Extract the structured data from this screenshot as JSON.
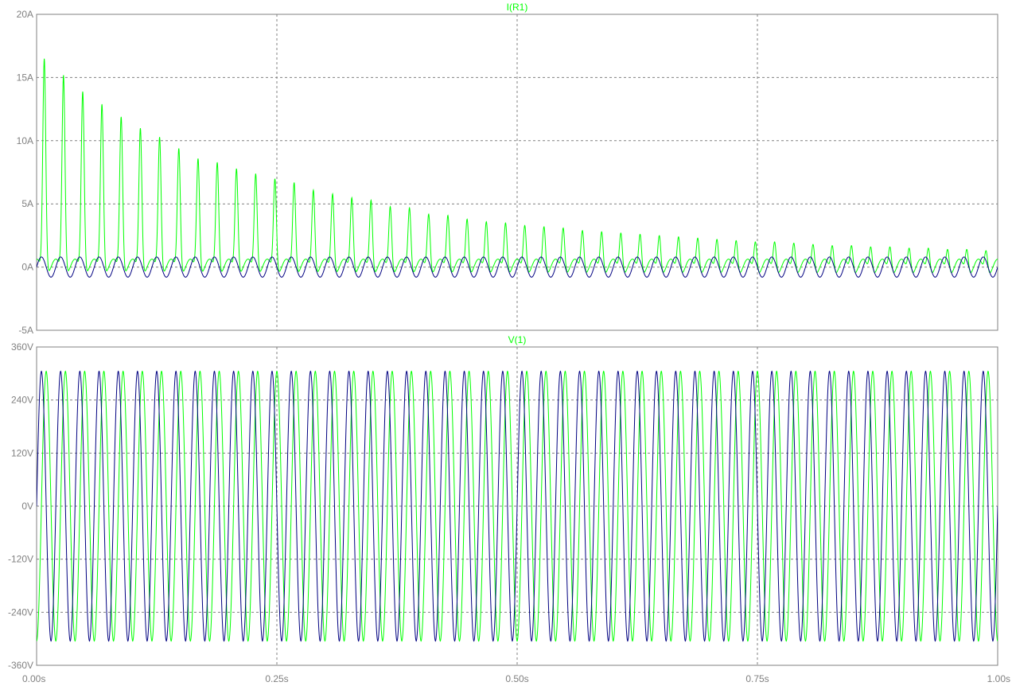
{
  "chart_data": [
    {
      "type": "line",
      "title": "I(R1)",
      "xlim": [
        0,
        1.0
      ],
      "ylim": [
        -5,
        20
      ],
      "yticks": [
        {
          "value": 20,
          "label": "20A"
        },
        {
          "value": 15,
          "label": "15A"
        },
        {
          "value": 10,
          "label": "10A"
        },
        {
          "value": 5,
          "label": "5A"
        },
        {
          "value": 0,
          "label": "0A"
        },
        {
          "value": -5,
          "label": "-5A"
        }
      ],
      "grid": true,
      "series": [
        {
          "color": "#00ff00",
          "description": "rectified current pulses, one per cycle, decaying peaks",
          "sample_peaks": {
            "t": [
              0.008,
              0.028,
              0.048,
              0.068,
              0.088,
              0.108,
              0.128,
              0.148,
              0.168,
              0.188,
              0.208,
              0.228,
              0.248,
              0.268,
              0.288,
              0.308,
              0.328,
              0.348,
              0.368,
              0.388,
              0.408,
              0.428,
              0.448,
              0.468,
              0.488,
              0.508,
              0.528,
              0.548,
              0.568,
              0.588,
              0.608,
              0.628,
              0.648,
              0.668,
              0.688,
              0.708,
              0.728,
              0.748,
              0.768,
              0.788,
              0.808,
              0.828,
              0.848,
              0.868,
              0.888,
              0.908,
              0.928,
              0.948,
              0.968,
              0.988
            ],
            "peak": [
              16.3,
              15.0,
              13.7,
              12.7,
              11.7,
              10.8,
              10.1,
              9.2,
              8.4,
              8.1,
              7.6,
              7.2,
              6.8,
              6.5,
              5.9,
              5.6,
              5.3,
              5.1,
              4.6,
              4.5,
              4.0,
              3.9,
              3.6,
              3.4,
              3.3,
              3.1,
              3.0,
              2.9,
              2.7,
              2.6,
              2.5,
              2.4,
              2.3,
              2.2,
              2.1,
              2.0,
              1.9,
              1.8,
              1.8,
              1.7,
              1.6,
              1.5,
              1.5,
              1.4,
              1.4,
              1.3,
              1.3,
              1.2,
              1.2,
              1.1
            ],
            "baseline": -0.7
          }
        },
        {
          "color": "#000080",
          "description": "sinusoidal current",
          "amplitude": 0.8,
          "frequency_hz": 50
        }
      ]
    },
    {
      "type": "line",
      "title": "V(1)",
      "xlim": [
        0,
        1.0
      ],
      "ylim": [
        -360,
        360
      ],
      "yticks": [
        {
          "value": 360,
          "label": "360V"
        },
        {
          "value": 240,
          "label": "240V"
        },
        {
          "value": 120,
          "label": "120V"
        },
        {
          "value": 0,
          "label": "0V"
        },
        {
          "value": -120,
          "label": "-120V"
        },
        {
          "value": -240,
          "label": "-240V"
        },
        {
          "value": -360,
          "label": "-360V"
        }
      ],
      "grid": true,
      "series": [
        {
          "color": "#00ff00",
          "amplitude": 305,
          "frequency_hz": 50,
          "phase_deg": -90
        },
        {
          "color": "#000080",
          "amplitude": 305,
          "frequency_hz": 50,
          "phase_deg": 0
        }
      ]
    }
  ],
  "xaxis": {
    "ticks": [
      {
        "value": 0.0,
        "label": "0.00s"
      },
      {
        "value": 0.25,
        "label": "0.25s"
      },
      {
        "value": 0.5,
        "label": "0.50s"
      },
      {
        "value": 0.75,
        "label": "0.75s"
      },
      {
        "value": 1.0,
        "label": "1.00s"
      }
    ]
  },
  "colors": {
    "axis_text": "#808080",
    "title_text": "#00ff00",
    "grid": "#808080",
    "frame": "#808080"
  }
}
